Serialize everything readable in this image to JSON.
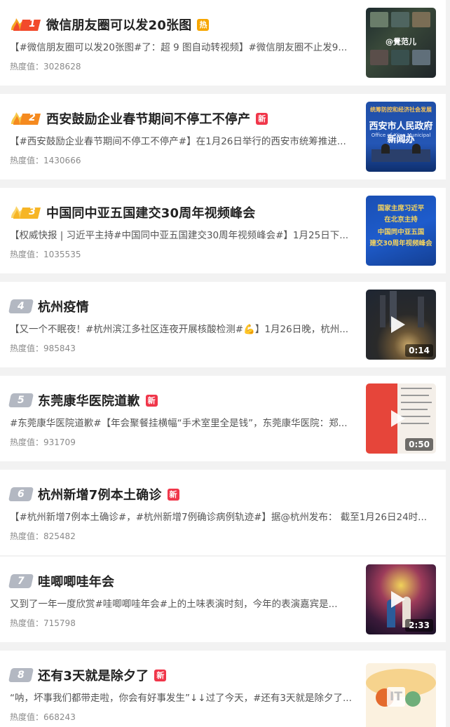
{
  "heat_label": "热度值：",
  "items": [
    {
      "rank": "1",
      "title": "微信朋友圈可以发20张图",
      "tag": "热",
      "tag_type": "hot",
      "summary": "【#微信朋友圈可以发20张图#了：超 9 图自动转视频】#微信朋友圈不止发9...",
      "heat": "3028628",
      "thumb_text": "@覺范儿"
    },
    {
      "rank": "2",
      "title": "西安鼓励企业春节期间不停工不停产",
      "tag": "新",
      "tag_type": "new",
      "summary": "【#西安鼓励企业春节期间不停工不停产#】在1月26日举行的西安市统筹推进...",
      "heat": "1430666",
      "thumb_text": "西安市人民政府新闻办",
      "thumb_sub": "Office of Xi'an Municipal People's"
    },
    {
      "rank": "3",
      "title": "中国同中亚五国建交30周年视频峰会",
      "tag": "",
      "tag_type": "",
      "summary": "【权威快报 | 习近平主持#中国同中亚五国建交30周年视频峰会#】1月25日下...",
      "heat": "1035535",
      "thumb_lines": [
        "国家主席习近平",
        "在北京主持",
        "中国同中亚五国",
        "建交30周年视频峰会"
      ]
    },
    {
      "rank": "4",
      "title": "杭州疫情",
      "tag": "",
      "tag_type": "",
      "summary": "【又一个不眠夜！#杭州滨江多社区连夜开展核酸检测#💪】1月26日晚，杭州...",
      "heat": "985843",
      "duration": "0:14"
    },
    {
      "rank": "5",
      "title": "东莞康华医院道歉",
      "tag": "新",
      "tag_type": "new",
      "summary": "#东莞康华医院道歉#【年会聚餐挂横幅“手术室里全是钱”，东莞康华医院：郑...",
      "heat": "931709",
      "duration": "0:50"
    },
    {
      "rank": "6",
      "title": "杭州新增7例本土确诊",
      "tag": "新",
      "tag_type": "new",
      "summary": "【#杭州新增7例本土确诊#，#杭州新增7例确诊病例轨迹#】据@杭州发布： 截至1月26日24时...",
      "heat": "825482"
    },
    {
      "rank": "7",
      "title": "哇唧唧哇年会",
      "tag": "",
      "tag_type": "",
      "summary": "又到了一年一度欣赏#哇唧唧哇年会#上的土味表演时刻，今年的表演嘉宾是...",
      "heat": "715798",
      "duration": "2:33"
    },
    {
      "rank": "8",
      "title": "还有3天就是除夕了",
      "tag": "新",
      "tag_type": "new",
      "summary": "“呐，坏事我们都带走啦，你会有好事发生”↓↓过了今天，#还有3天就是除夕了...",
      "heat": "668243",
      "thumb_logo": "IT"
    }
  ]
}
